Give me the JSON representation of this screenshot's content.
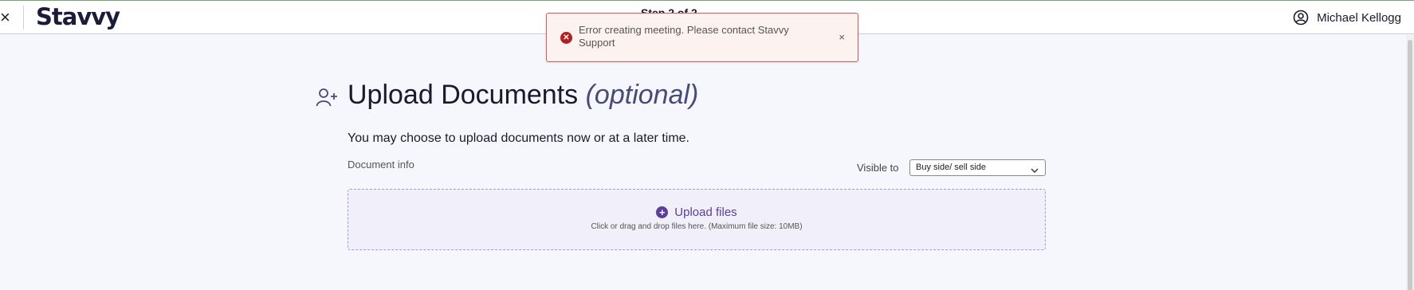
{
  "topbar": {
    "close_glyph": "×",
    "logo": "Stavvy",
    "step": "Step 2 of 2",
    "user_name": "Michael Kellogg",
    "user_icon": "account-circle-icon"
  },
  "toast": {
    "icon": "error-circle-icon",
    "message": "Error creating meeting. Please contact Stavvy Support",
    "close_glyph": "×",
    "border_color": "#d65a5a",
    "background": "#fcf3f1"
  },
  "main": {
    "heading_icon": "add-user-icon",
    "title": "Upload Documents",
    "title_optional": "(optional)",
    "intro": "You may choose to upload documents now or at a later time.",
    "document_info_label": "Document info",
    "visible_to_label": "Visible to",
    "visible_to_value": "Buy side/ sell side",
    "upload": {
      "icon": "plus-circle-icon",
      "label": "Upload files",
      "hint": "Click or drag and drop files here. (Maximum file size: 10MB)"
    }
  },
  "colors": {
    "accent": "#5b3e9a",
    "error": "#b22020",
    "page_background": "#f6f7fc"
  }
}
